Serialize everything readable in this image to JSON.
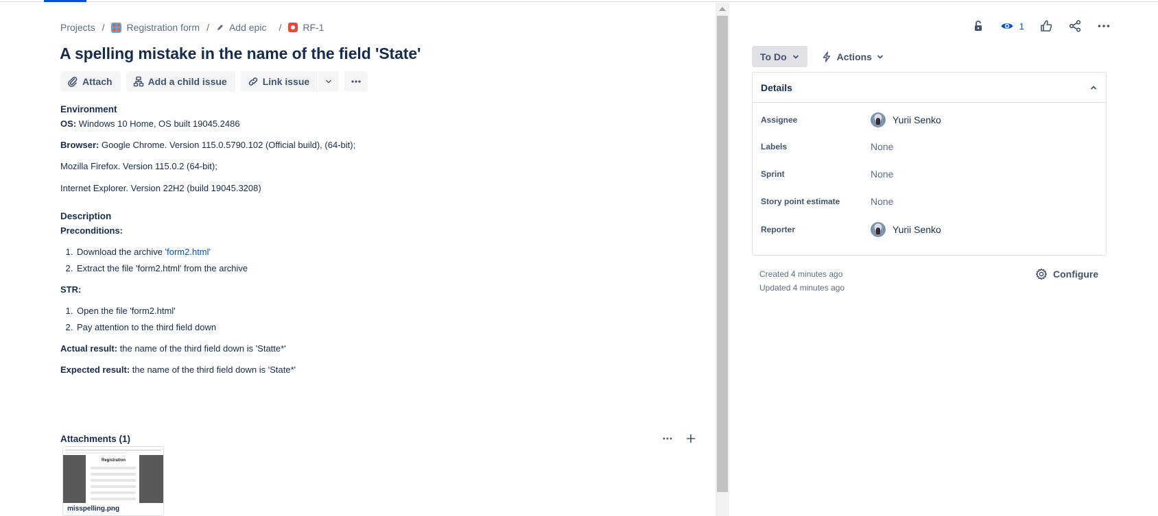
{
  "breadcrumb": {
    "projects": "Projects",
    "project_name": "Registration form",
    "epic": "Add epic",
    "issue_key": "RF-1"
  },
  "issue": {
    "title": "A spelling mistake in the name of the field 'State'"
  },
  "toolbar": {
    "attach": "Attach",
    "add_child": "Add a child issue",
    "link_issue": "Link issue"
  },
  "environment": {
    "label": "Environment",
    "os_label": "OS:",
    "os_value": " Windows 10 Home, OS built 19045.2486",
    "browser_label": "Browser:",
    "browser_value": " Google Chrome. Version 115.0.5790.102 (Official build), (64-bit);",
    "firefox": "Mozilla Firefox. Version 115.0.2 (64-bit);",
    "ie": "Internet Explorer. Version 22H2 (build 19045.3208)"
  },
  "description": {
    "label": "Description",
    "preconditions_label": "Preconditions:",
    "pre1_text": "Download the archive ",
    "pre1_link": "'form2.html'",
    "pre2": "Extract the file 'form2.html' from the archive",
    "str_label": "STR:",
    "str1": "Open the file 'form2.html'",
    "str2": "Pay attention to the third field down",
    "actual_label": "Actual result:",
    "actual_value": " the name of the third field down is 'Statte*'",
    "expected_label": "Expected result:",
    "expected_value": " the name of the third field down is 'State*'"
  },
  "attachments": {
    "label": "Attachments (1)",
    "file_name": "misspelling.png",
    "thumb_title": "Registration"
  },
  "watchers": {
    "count": "1"
  },
  "status": {
    "current": "To Do",
    "actions": "Actions"
  },
  "details": {
    "header": "Details",
    "assignee_label": "Assignee",
    "assignee_value": "Yurii Senko",
    "labels_label": "Labels",
    "labels_value": "None",
    "sprint_label": "Sprint",
    "sprint_value": "None",
    "story_points_label": "Story point estimate",
    "story_points_value": "None",
    "reporter_label": "Reporter",
    "reporter_value": "Yurii Senko"
  },
  "meta": {
    "created": "Created 4 minutes ago",
    "updated": "Updated 4 minutes ago",
    "configure": "Configure"
  },
  "colors": {
    "accent": "#0052cc",
    "text": "#172b4d",
    "subtle": "#42526e",
    "bug": "#e5493a"
  }
}
